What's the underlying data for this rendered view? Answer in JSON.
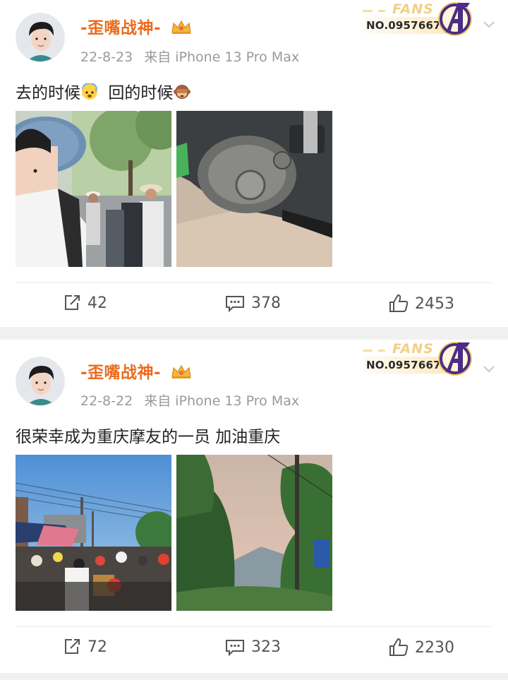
{
  "posts": [
    {
      "username": "-歪嘴战神-",
      "date": "22-8-23",
      "source": "来自 iPhone 13 Pro Max",
      "text_part1": "去的时候",
      "text_part2": "回的时候",
      "emoji_1": "cold-sweat-face",
      "emoji_2": "see-no-evil-monkey",
      "fans_badge": {
        "word": "FANS",
        "number": "NO.0957667"
      },
      "photos": [
        "selfie-with-hat-in-crowd",
        "motorcycle-engine-closeup"
      ],
      "actions": {
        "share": "42",
        "comment": "378",
        "like": "2453"
      }
    },
    {
      "username": "-歪嘴战神-",
      "date": "22-8-22",
      "source": "来自 iPhone 13 Pro Max",
      "text_part1": "很荣幸成为重庆摩友的一员 加油重庆",
      "fans_badge": {
        "word": "FANS",
        "number": "NO.0957667"
      },
      "photos": [
        "motorcycle-crowd-street",
        "mountain-smoke-trees"
      ],
      "actions": {
        "share": "72",
        "comment": "323",
        "like": "2230"
      }
    }
  ],
  "colors": {
    "username": "#ea6c1f",
    "meta": "#9a9a9a",
    "fans_gold": "#f1cf86",
    "avengers_purple": "#4b2c86"
  }
}
